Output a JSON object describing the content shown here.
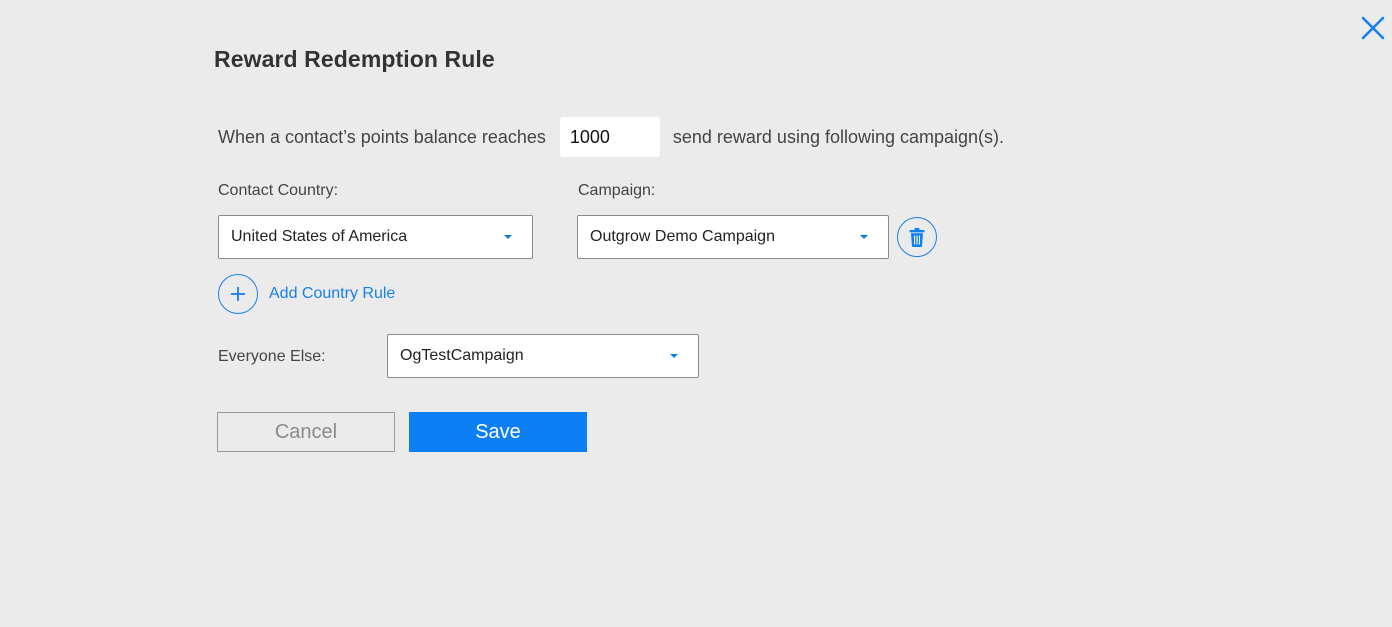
{
  "dialog": {
    "title": "Reward Redemption Rule",
    "close_icon": "close-icon"
  },
  "rule": {
    "prefix": "When a contact’s points balance reaches",
    "points_value": "1000",
    "suffix": "send reward using following campaign(s)."
  },
  "country_rule": {
    "country_label": "Contact Country:",
    "country_value": "United States of America",
    "campaign_label": "Campaign:",
    "campaign_value": "Outgrow Demo Campaign",
    "delete_icon": "trash-icon"
  },
  "add_rule": {
    "label": "Add Country Rule",
    "icon": "plus-icon"
  },
  "everyone_else": {
    "label": "Everyone Else:",
    "campaign_value": "OgTestCampaign"
  },
  "actions": {
    "cancel_label": "Cancel",
    "save_label": "Save"
  },
  "colors": {
    "accent": "#0d7ff5",
    "background": "#ebebeb"
  }
}
